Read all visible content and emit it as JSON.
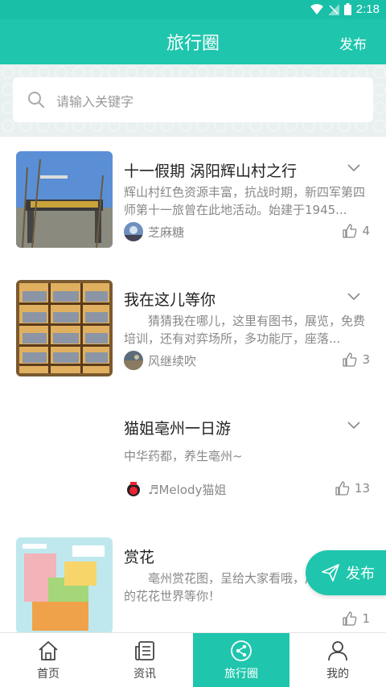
{
  "status_bar": {
    "time": "2:18"
  },
  "header": {
    "title": "旅行圈",
    "publish_label": "发布"
  },
  "search": {
    "placeholder": "请输入关键字"
  },
  "posts": [
    {
      "title": "十一假期 涡阳辉山村之行",
      "description": "辉山村红色资源丰富，抗战时期，新四军第四师第十一旅曾在此地活动。始建于1945...",
      "author": "芝麻糖",
      "likes": "4"
    },
    {
      "title": "我在这儿等你",
      "description": "　　猜猜我在哪儿，这里有图书，展览，免费培训，还有对弈场所，多功能厅，座落...",
      "author": "风继续吹",
      "likes": "3"
    },
    {
      "title": "猫姐亳州一日游",
      "description": "中华药都，养生亳州~",
      "author": "♬Melody猫姐",
      "likes": "13"
    },
    {
      "title": "赏花",
      "description": "　　亳州赏花图，呈给大家看哦，展现不一样的花花世界等你！",
      "author": "",
      "likes": "1"
    }
  ],
  "fab": {
    "label": "发布"
  },
  "tabs": [
    {
      "label": "首页",
      "active": false
    },
    {
      "label": "资讯",
      "active": false
    },
    {
      "label": "旅行圈",
      "active": true
    },
    {
      "label": "我的",
      "active": false
    }
  ],
  "colors": {
    "accent": "#1fc6ad",
    "status_bar": "#19bfa7"
  }
}
